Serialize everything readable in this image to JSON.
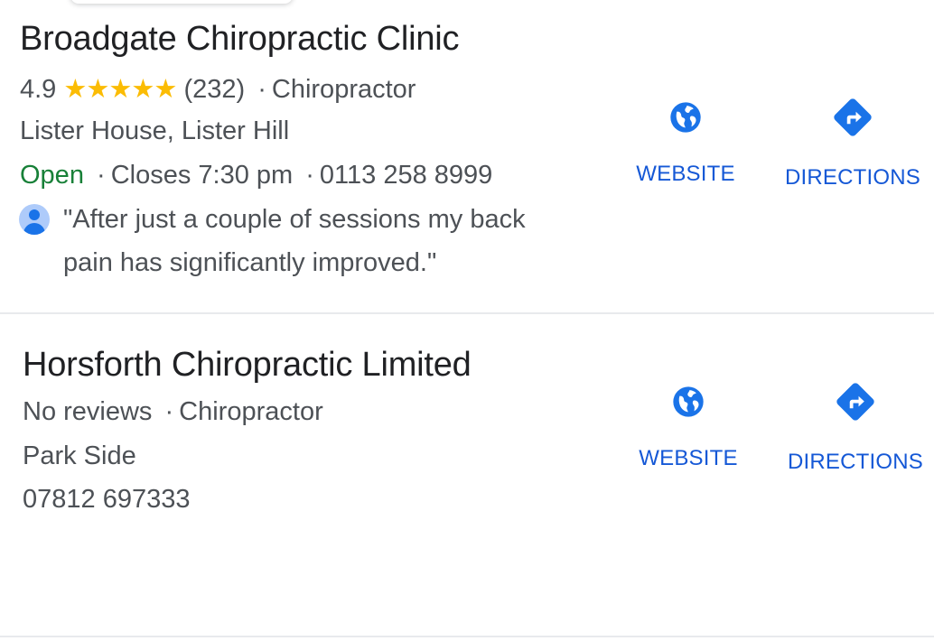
{
  "listings": [
    {
      "name": "Broadgate Chiropractic Clinic",
      "rating": "4.9",
      "stars_glyphs": "★★★★★",
      "stars_value": 5,
      "review_count": "(232)",
      "category": "Chiropractor",
      "address": "Lister House, Lister Hill",
      "open_status": "Open",
      "closes": "Closes 7:30 pm",
      "phone": "0113 258 8999",
      "review_line1": "\"After just a couple of sessions my back",
      "review_line2": "pain has significantly improved.\"",
      "website_label": "WEBSITE",
      "directions_label": "DIRECTIONS"
    },
    {
      "name": "Horsforth Chiropractic Limited",
      "reviews": "No reviews",
      "category": "Chiropractor",
      "address": "Park Side",
      "phone": "07812 697333",
      "website_label": "WEBSITE",
      "directions_label": "DIRECTIONS"
    }
  ],
  "separator": "·",
  "icons": {
    "website": "globe-icon",
    "directions": "directions-icon",
    "reviewer": "avatar-icon"
  },
  "colors": {
    "link_blue": "#1558d6",
    "icon_blue": "#1a73e8",
    "open_green": "#188038",
    "star_yellow": "#fbbc04",
    "text_gray": "#4d5156",
    "title_black": "#202124"
  }
}
